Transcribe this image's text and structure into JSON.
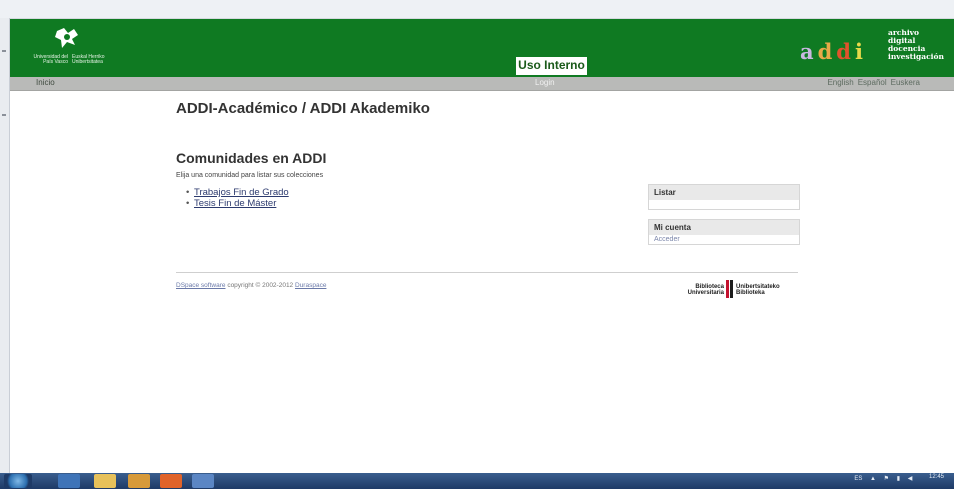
{
  "header": {
    "upv_logo": {
      "line1": "Universidad del País Vasco",
      "line2": "Euskal Herriko Unibertsitatea"
    },
    "banner_label": "Uso Interno",
    "addi_logo": {
      "letters": [
        "a",
        "d",
        "d",
        "i"
      ],
      "words": [
        "archivo",
        "digital",
        "docencia",
        "investigación"
      ]
    }
  },
  "nav": {
    "home": "Inicio",
    "login": "Login",
    "languages": [
      "English",
      "Español",
      "Euskera"
    ]
  },
  "main": {
    "title": "ADDI-Académico / ADDI Akademiko",
    "section_title": "Comunidades en ADDI",
    "instruction": "Elija una comunidad para listar sus colecciones",
    "communities": [
      "Trabajos Fin de Grado",
      "Tesis Fin de Máster"
    ]
  },
  "sidebar": {
    "browse_title": "Listar",
    "account_title": "Mi cuenta",
    "account_link": "Acceder"
  },
  "footer": {
    "software_link": "DSpace software",
    "copyright": "copyright © 2002-2012",
    "duraspace_link": "Duraspace",
    "library_left": [
      "Biblioteca",
      "Universitaria"
    ],
    "library_right": [
      "Unibertsitateko",
      "Biblioteka"
    ]
  },
  "taskbar": {
    "lang_indicator": "ES",
    "clock_time": "12:45"
  },
  "colors": {
    "header_green": "#0f7a22",
    "nav_gray": "#b9bab8",
    "link_blue": "#2c3a6e",
    "taskbar_blue": "#1e3a66"
  }
}
